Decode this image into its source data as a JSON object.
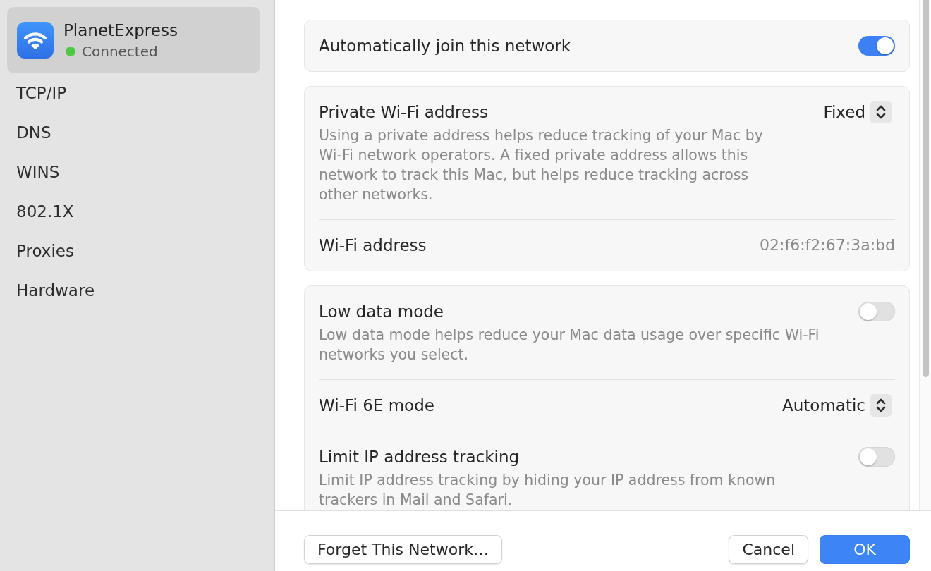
{
  "sidebar": {
    "network": {
      "name": "PlanetExpress",
      "status": "Connected",
      "selected": true
    },
    "items": [
      {
        "label": "TCP/IP",
        "selected": false
      },
      {
        "label": "DNS",
        "selected": false
      },
      {
        "label": "WINS",
        "selected": false
      },
      {
        "label": "802.1X",
        "selected": false
      },
      {
        "label": "Proxies",
        "selected": false
      },
      {
        "label": "Hardware",
        "selected": false
      }
    ]
  },
  "sections": [
    {
      "rows": [
        {
          "kind": "toggle",
          "label": "Automatically join this network",
          "on": true
        }
      ]
    },
    {
      "rows": [
        {
          "kind": "popup",
          "label": "Private Wi-Fi address",
          "value": "Fixed",
          "description": "Using a private address helps reduce tracking of your Mac by Wi-Fi network operators. A fixed private address allows this network to track this Mac, but helps reduce tracking across other networks."
        },
        {
          "kind": "value",
          "label": "Wi-Fi address",
          "value": "02:f6:f2:67:3a:bd"
        }
      ]
    },
    {
      "rows": [
        {
          "kind": "toggle",
          "label": "Low data mode",
          "on": false,
          "description": "Low data mode helps reduce your Mac data usage over specific Wi-Fi networks you select."
        },
        {
          "kind": "popup",
          "label": "Wi-Fi 6E mode",
          "value": "Automatic"
        },
        {
          "kind": "toggle",
          "label": "Limit IP address tracking",
          "on": false,
          "description": "Limit IP address tracking by hiding your IP address from known trackers in Mail and Safari."
        }
      ]
    }
  ],
  "footer": {
    "left_buttons": [
      {
        "label": "Forget This Network…",
        "kind": "secondary"
      }
    ],
    "right_buttons": [
      {
        "label": "Cancel",
        "kind": "secondary"
      },
      {
        "label": "OK",
        "kind": "default"
      }
    ]
  }
}
